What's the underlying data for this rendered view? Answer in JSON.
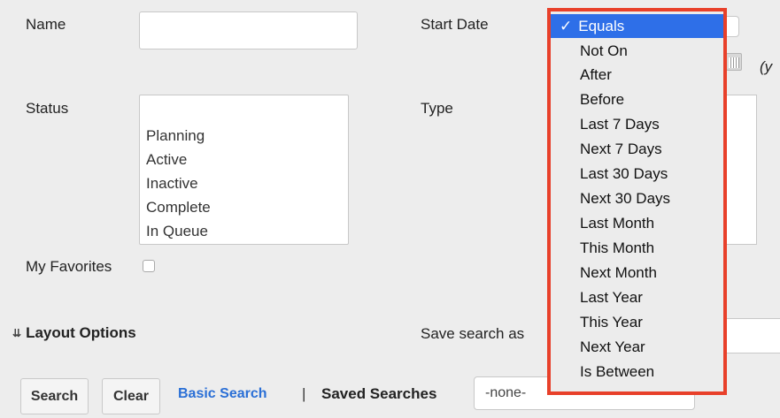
{
  "form": {
    "name_label": "Name",
    "name_value": "",
    "start_date_label": "Start Date",
    "date_format_hint": "(y",
    "status_label": "Status",
    "status_options": [
      "Planning",
      "Active",
      "Inactive",
      "Complete",
      "In Queue"
    ],
    "type_label": "Type",
    "my_favorites_label": "My Favorites",
    "layout_options_label": "Layout Options",
    "save_search_label": "Save search as"
  },
  "buttons": {
    "search": "Search",
    "clear": "Clear",
    "basic_search": "Basic Search",
    "separator": "|",
    "saved_searches_label": "Saved Searches",
    "saved_searches_value": "-none-"
  },
  "date_operator_menu": {
    "selected": "Equals",
    "check_mark": "✓",
    "items": [
      "Equals",
      "Not On",
      "After",
      "Before",
      "Last 7 Days",
      "Next 7 Days",
      "Last 30 Days",
      "Next 30 Days",
      "Last Month",
      "This Month",
      "Next Month",
      "Last Year",
      "This Year",
      "Next Year",
      "Is Between"
    ]
  },
  "colors": {
    "highlight_border": "#e8402a",
    "selected_bg": "#2e6fe8",
    "link": "#2a6fd6"
  }
}
